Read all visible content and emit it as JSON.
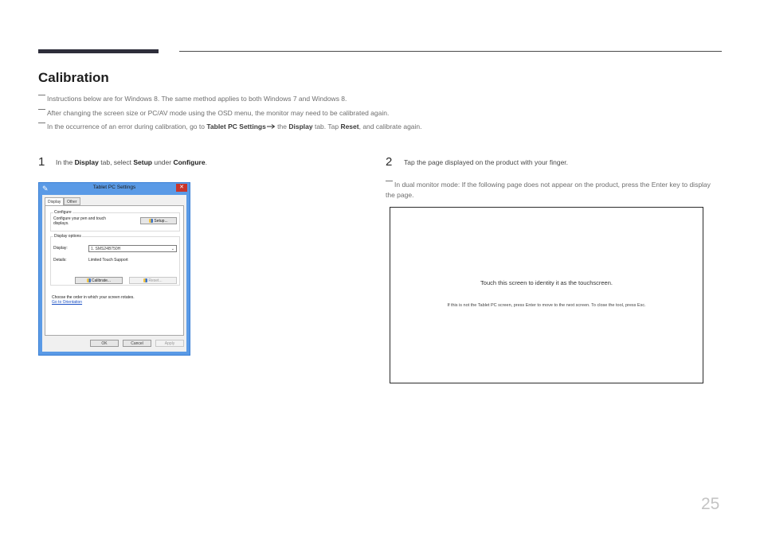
{
  "header": {
    "title": "Calibration"
  },
  "notes": [
    {
      "parts": [
        {
          "t": "Instructions below are for Windows 8. The same method applies to both Windows 7 and Windows 8."
        }
      ]
    },
    {
      "parts": [
        {
          "t": "After changing the screen size or PC/AV mode using the OSD menu, the monitor may need to be calibrated again."
        }
      ]
    },
    {
      "parts": [
        {
          "t": "In the occurrence of an error during calibration, go to "
        },
        {
          "t": "Tablet PC Settings",
          "b": true
        },
        {
          "arrow": true
        },
        {
          "t": " the "
        },
        {
          "t": "Display",
          "b": true
        },
        {
          "t": " tab. Tap "
        },
        {
          "t": "Reset",
          "b": true
        },
        {
          "t": ", and calibrate again."
        }
      ]
    }
  ],
  "step1": {
    "number": "1",
    "parts": [
      {
        "t": "In the "
      },
      {
        "t": "Display",
        "b": true
      },
      {
        "t": " tab, select "
      },
      {
        "t": "Setup",
        "b": true
      },
      {
        "t": " under "
      },
      {
        "t": "Configure",
        "b": true
      },
      {
        "t": "."
      }
    ]
  },
  "dialog": {
    "title": "Tablet PC Settings",
    "close": "✕",
    "tabs": [
      "Display",
      "Other"
    ],
    "configure_label": "Configure",
    "configure_text_1": "Configure your pen and touch",
    "configure_text_2": "displays.",
    "setup_button": "Setup...",
    "display_options_label": "Display options",
    "display_label": "Display:",
    "display_value": "1. SMS24B750H",
    "details_label": "Details:",
    "details_value": "Limited Touch Support",
    "calibrate_button": "Calibrate...",
    "reset_button": "Reset...",
    "orientation_text": "Choose the order in which your screen rotates.",
    "orientation_link": "Go to Orientation",
    "ok_button": "OK",
    "cancel_button": "Cancel",
    "apply_button": "Apply"
  },
  "step2": {
    "number": "2",
    "text": "Tap the page displayed on the product with your finger.",
    "note": "In dual monitor mode: If the following page does not appear on the product, press the Enter key to display the page."
  },
  "touch_screen": {
    "main": "Touch this screen to identity it as the touchscreen.",
    "sub": "If this is not the Tablet PC screen, press Enter to move to the next screen. To close the tool, press Esc."
  },
  "page_number": "25"
}
